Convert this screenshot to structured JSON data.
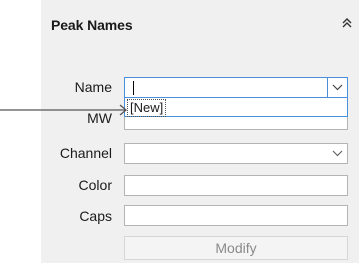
{
  "panel": {
    "title": "Peak Names",
    "collapse_icon": "double-chevron-up-icon"
  },
  "fields": {
    "name": {
      "label": "Name",
      "value": ""
    },
    "mw": {
      "label": "MW",
      "value": ""
    },
    "channel": {
      "label": "Channel",
      "value": ""
    },
    "color": {
      "label": "Color",
      "value": ""
    },
    "caps": {
      "label": "Caps",
      "value": ""
    }
  },
  "dropdown": {
    "items": [
      "[New]"
    ]
  },
  "buttons": {
    "modify_label": "Modify"
  },
  "colors": {
    "focus_border": "#4a90d9",
    "panel_bg": "#f0f0f0",
    "disabled_text": "#8a8a8a"
  }
}
